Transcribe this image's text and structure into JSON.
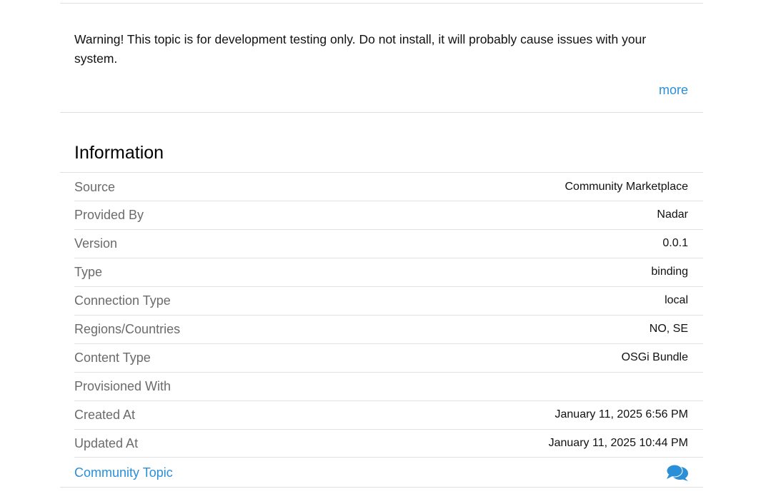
{
  "description": {
    "warning_text": "Warning! This topic is for development testing only. Do not install, it will probably cause issues with your system.",
    "more_label": "more"
  },
  "information": {
    "title": "Information",
    "rows": [
      {
        "label": "Source",
        "value": "Community Marketplace"
      },
      {
        "label": "Provided By",
        "value": "Nadar"
      },
      {
        "label": "Version",
        "value": "0.0.1"
      },
      {
        "label": "Type",
        "value": "binding"
      },
      {
        "label": "Connection Type",
        "value": "local"
      },
      {
        "label": "Regions/Countries",
        "value": "NO, SE"
      },
      {
        "label": "Content Type",
        "value": "OSGi Bundle"
      },
      {
        "label": "Provisioned With",
        "value": ""
      },
      {
        "label": "Created At",
        "value": "January 11, 2025 6:56 PM"
      },
      {
        "label": "Updated At",
        "value": "January 11, 2025 10:44 PM"
      }
    ],
    "community_topic_label": "Community Topic",
    "community_topic_icon": "chat-bubbles-icon"
  },
  "colors": {
    "link": "#2a8fd6",
    "label": "#6b6b6b",
    "divider": "#e0e0e0"
  }
}
